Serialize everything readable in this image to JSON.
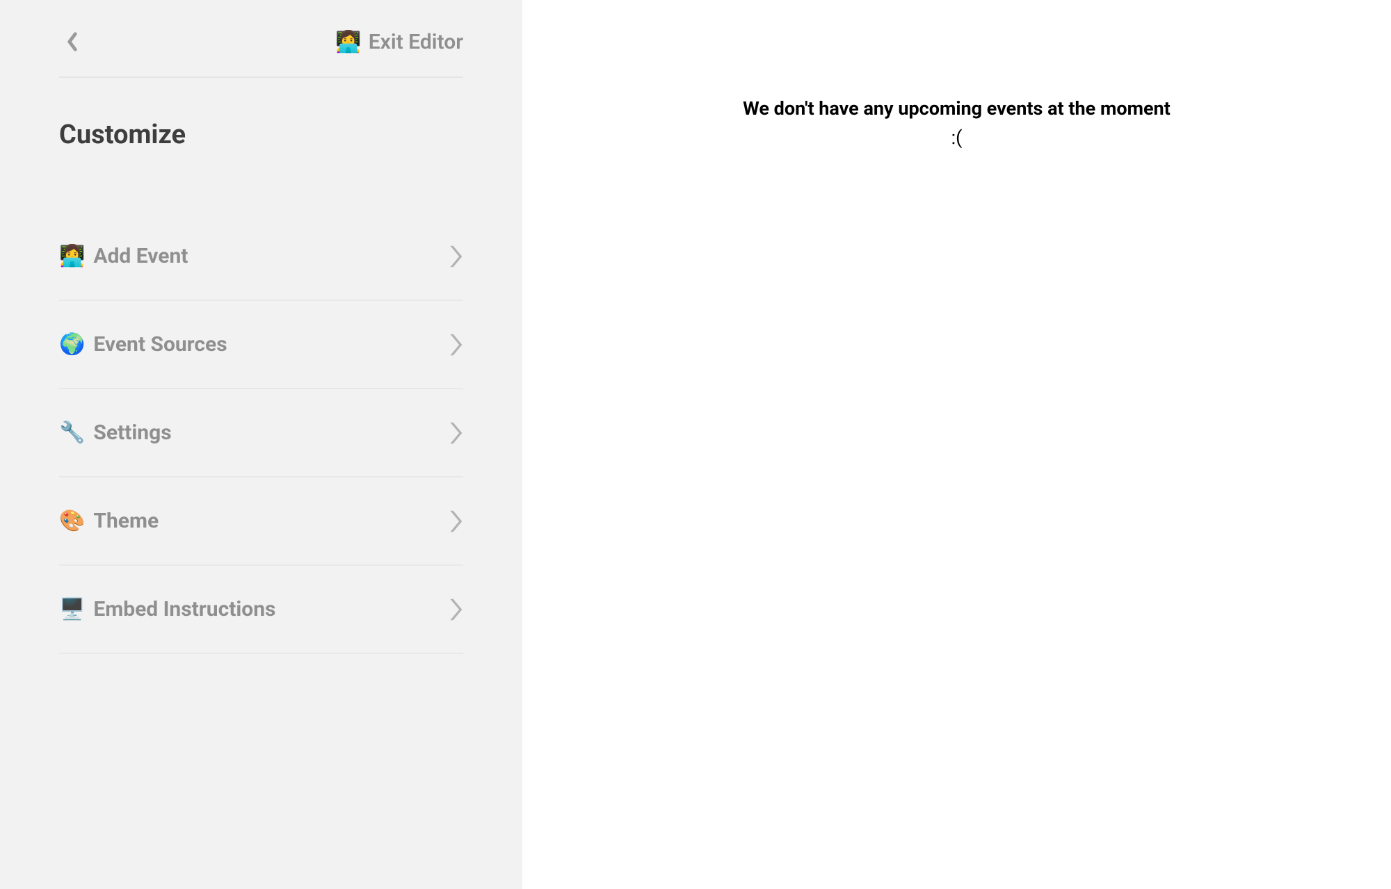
{
  "header": {
    "exit_label": "Exit Editor",
    "exit_emoji": "👩‍💻"
  },
  "sidebar": {
    "title": "Customize",
    "items": [
      {
        "emoji": "👩‍💻",
        "label": "Add Event"
      },
      {
        "emoji": "🌍",
        "label": "Event Sources"
      },
      {
        "emoji": "🔧",
        "label": "Settings"
      },
      {
        "emoji": "🎨",
        "label": "Theme"
      },
      {
        "emoji": "🖥️",
        "label": "Embed Instructions"
      }
    ]
  },
  "preview": {
    "empty_line1": "We don't have any upcoming events at the moment",
    "empty_line2": ":("
  }
}
